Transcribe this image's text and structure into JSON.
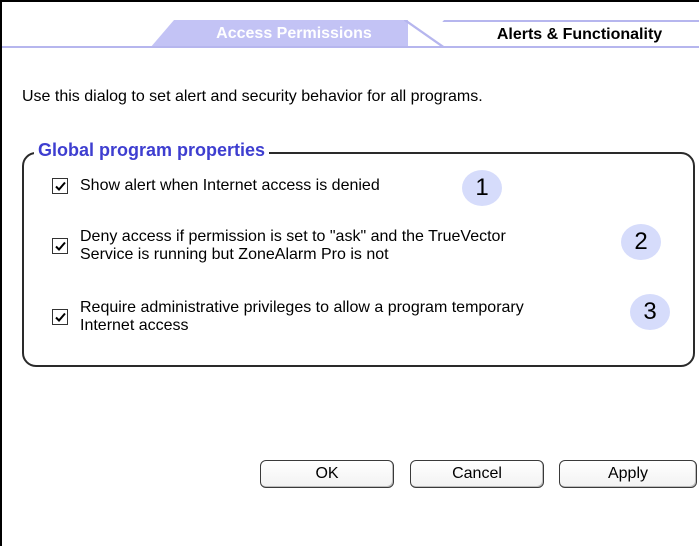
{
  "tabs": [
    {
      "label": "Access Permissions",
      "active": false
    },
    {
      "label": "Alerts & Functionality",
      "active": true
    }
  ],
  "intro_text": "Use this dialog to set alert and security behavior for all programs.",
  "group": {
    "title": "Global program properties",
    "options": [
      {
        "line1": "Show alert when Internet access is denied",
        "line2": "",
        "checked": true,
        "badge": "1"
      },
      {
        "line1": "Deny access if permission is set to \"ask\" and the TrueVector",
        "line2": "Service is running but ZoneAlarm Pro is not",
        "checked": true,
        "badge": "2"
      },
      {
        "line1": "Require administrative privileges to allow a program temporary",
        "line2": "Internet access",
        "checked": true,
        "badge": "3"
      }
    ]
  },
  "buttons": {
    "ok": "OK",
    "cancel": "Cancel",
    "apply": "Apply"
  },
  "colors": {
    "tab_inactive_bg": "#c3c3f5",
    "group_title": "#3e3ed0",
    "badge_bg": "#d6dcfb"
  }
}
